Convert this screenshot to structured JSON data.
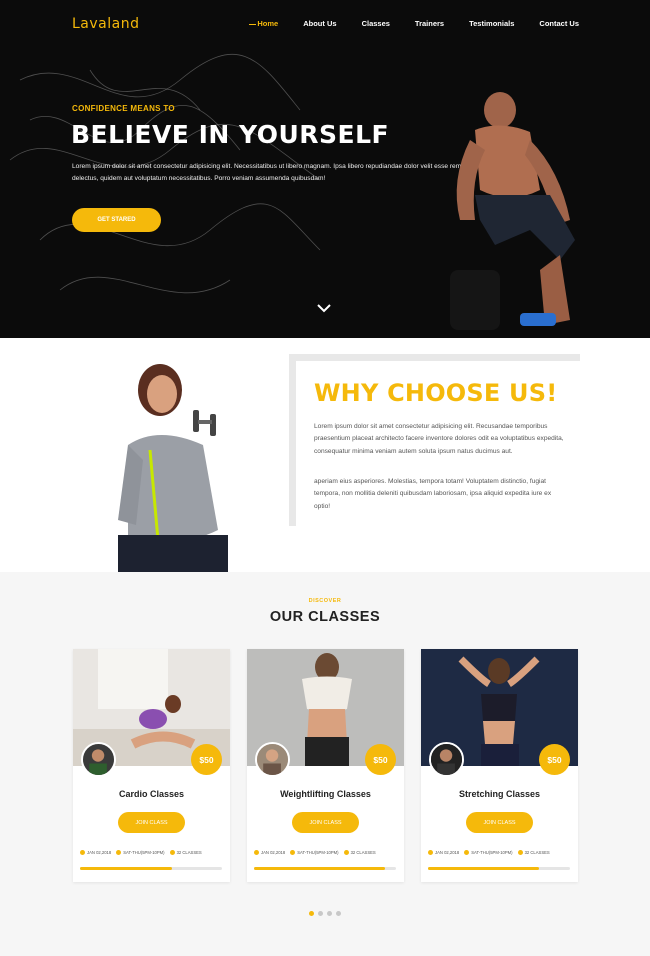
{
  "brand": {
    "logo": "Lavaland",
    "accent": "#f5b90b"
  },
  "nav": {
    "items": [
      "Home",
      "About Us",
      "Classes",
      "Trainers",
      "Testimonials",
      "Contact Us"
    ],
    "active": "Home"
  },
  "hero": {
    "kicker": "CONFIDENCE MEANS TO",
    "title": "BELIEVE IN YOURSELF",
    "description": "Lorem ipsum dolor sit amet consectetur adipisicing elit. Necessitatibus ut libero magnam. Ipsa libero repudiandae dolor velit esse rem illum aliquid delectus, quidem aut voluptatum necessitatibus. Porro veniam assumenda quibusdam!",
    "cta": "GET STARED",
    "scroll_icon": "chevron-down-icon"
  },
  "why": {
    "title": "WHY CHOOSE US!",
    "p1": "Lorem ipsum dolor sit amet consectetur adipisicing elit. Recusandae temporibus praesentium placeat architecto facere inventore dolores odit ea voluptatibus expedita, consequatur minima veniam autem soluta ipsum natus ducimus aut.",
    "p2": "aperiam eius asperiores. Molestias, tempora totam! Voluptatem distinctio, fugiat tempora, non mollitia deleniti quibusdam laboriosam, ipsa aliquid expedita iure ex optio!"
  },
  "classes": {
    "kicker": "DISCOVER",
    "title": "OUR CLASSES",
    "cards": [
      {
        "title": "Cardio Classes",
        "price": "$50",
        "join": "JOIN CLASS",
        "date": "JAN 02,2018",
        "time": "SAT-THU(5PM-10PM)",
        "count": "32 CLASSES",
        "progress": 0.65
      },
      {
        "title": "Weightlifting Classes",
        "price": "$50",
        "join": "JOIN CLASS",
        "date": "JAN 02,2018",
        "time": "SAT-THU(5PM-10PM)",
        "count": "32 CLASSES",
        "progress": 0.92
      },
      {
        "title": "Stretching Classes",
        "price": "$50",
        "join": "JOIN CLASS",
        "date": "JAN 02,2018",
        "time": "SAT-THU(5PM-10PM)",
        "count": "32 CLASSES",
        "progress": 0.78
      }
    ],
    "carousel": {
      "pages": 4,
      "active": 1
    }
  }
}
